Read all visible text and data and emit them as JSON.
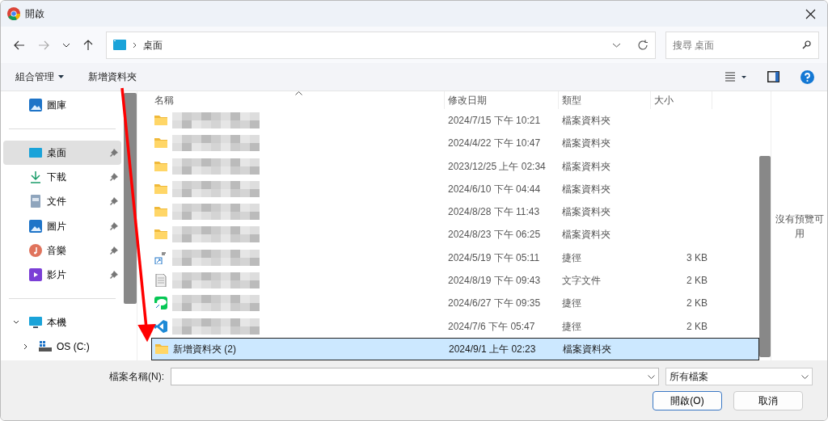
{
  "window": {
    "title": "開啟"
  },
  "address": {
    "path": "桌面"
  },
  "search": {
    "placeholder": "搜尋 桌面"
  },
  "toolbar": {
    "organize": "組合管理",
    "new_folder": "新增資料夾"
  },
  "sidebar": {
    "items": [
      {
        "label": "圖庫",
        "pinned": false,
        "selected": false
      },
      {
        "label": "桌面",
        "pinned": true,
        "selected": true
      },
      {
        "label": "下載",
        "pinned": true,
        "selected": false
      },
      {
        "label": "文件",
        "pinned": true,
        "selected": false
      },
      {
        "label": "圖片",
        "pinned": true,
        "selected": false
      },
      {
        "label": "音樂",
        "pinned": true,
        "selected": false
      },
      {
        "label": "影片",
        "pinned": true,
        "selected": false
      },
      {
        "label": "本機",
        "expanded": true,
        "selected": false,
        "children": [
          {
            "label": "OS (C:)",
            "expanded": false,
            "selected": false
          }
        ]
      }
    ]
  },
  "table": {
    "columns": [
      "名稱",
      "修改日期",
      "類型",
      "大小"
    ],
    "rows": [
      {
        "kind": "folder",
        "modified": "2024/7/15 下午 10:21",
        "type": "檔案資料夾",
        "selected": false
      },
      {
        "kind": "folder",
        "modified": "2024/4/22 下午 10:47",
        "type": "檔案資料夾",
        "selected": false
      },
      {
        "kind": "folder",
        "modified": "2023/12/25 上午 02:34",
        "type": "檔案資料夾",
        "selected": false
      },
      {
        "kind": "folder",
        "modified": "2024/6/10 下午 04:44",
        "type": "檔案資料夾",
        "selected": false
      },
      {
        "kind": "folder",
        "modified": "2024/8/28 下午 11:43",
        "type": "檔案資料夾",
        "selected": false
      },
      {
        "kind": "folder",
        "modified": "2024/8/23 下午 06:25",
        "type": "檔案資料夾",
        "selected": false
      },
      {
        "kind": "shortcut-en",
        "modified": "2024/5/19 下午 05:11",
        "type": "捷徑",
        "size": "3 KB",
        "selected": false
      },
      {
        "kind": "text",
        "modified": "2024/8/19 下午 09:43",
        "type": "文字文件",
        "size": "2 KB",
        "selected": false
      },
      {
        "kind": "shortcut-chat",
        "modified": "2024/6/27 下午 09:35",
        "type": "捷徑",
        "size": "2 KB",
        "selected": false
      },
      {
        "kind": "shortcut-code",
        "modified": "2024/7/6 下午 05:47",
        "type": "捷徑",
        "size": "2 KB",
        "selected": false
      },
      {
        "kind": "folder",
        "name": "新增資料夾 (2)",
        "modified": "2024/9/1 上午 02:23",
        "type": "檔案資料夾",
        "selected": true
      }
    ]
  },
  "preview": {
    "message": "沒有預覽可用"
  },
  "filename": {
    "label": "檔案名稱(N):"
  },
  "filter": {
    "value": "所有檔案"
  },
  "buttons": [
    {
      "label": "開啟(O)",
      "default": true
    },
    {
      "label": "取消",
      "default": false
    }
  ]
}
